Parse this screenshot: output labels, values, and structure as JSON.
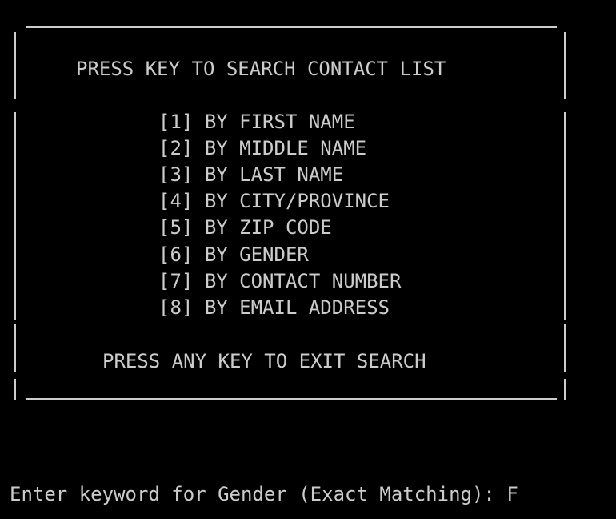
{
  "menu": {
    "title": "PRESS KEY TO SEARCH CONTACT LIST",
    "options": [
      {
        "key": "[1]",
        "label": "BY FIRST NAME"
      },
      {
        "key": "[2]",
        "label": "BY MIDDLE NAME"
      },
      {
        "key": "[3]",
        "label": "BY LAST NAME"
      },
      {
        "key": "[4]",
        "label": "BY CITY/PROVINCE"
      },
      {
        "key": "[5]",
        "label": "BY ZIP CODE"
      },
      {
        "key": "[6]",
        "label": "BY GENDER"
      },
      {
        "key": "[7]",
        "label": "BY CONTACT NUMBER"
      },
      {
        "key": "[8]",
        "label": "BY EMAIL ADDRESS"
      }
    ],
    "exit_hint": "PRESS ANY KEY TO EXIT SEARCH"
  },
  "prompt": {
    "text": "Enter keyword for Gender (Exact Matching): ",
    "input_value": "F"
  },
  "colors": {
    "background": "#000000",
    "foreground": "#cccccc"
  }
}
